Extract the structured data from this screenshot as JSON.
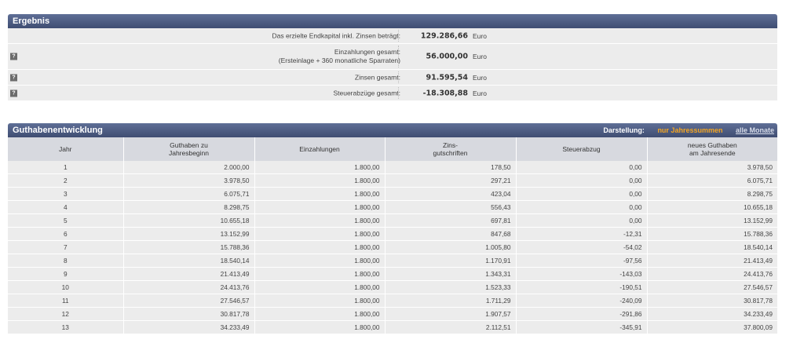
{
  "ergebnis": {
    "title": "Ergebnis",
    "rows": [
      {
        "label": "Das erzielte Endkapital inkl. Zinsen beträgt:",
        "label2": "",
        "value": "129.286,66",
        "unit": "Euro",
        "help": ""
      },
      {
        "label": "Einzahlungen gesamt:",
        "label2": "(Ersteinlage + 360 monatliche Sparraten)",
        "value": "56.000,00",
        "unit": "Euro",
        "help": "?"
      },
      {
        "label": "Zinsen gesamt:",
        "label2": "",
        "value": "91.595,54",
        "unit": "Euro",
        "help": "?"
      },
      {
        "label": "Steuerabzüge gesamt:",
        "label2": "",
        "value": "-18.308,88",
        "unit": "Euro",
        "help": "?"
      }
    ]
  },
  "guthaben": {
    "title": "Guthabenentwicklung",
    "darstellung_label": "Darstellung:",
    "active_option": "nur Jahressummen",
    "other_option": "alle Monate",
    "columns": [
      {
        "l1": "Jahr",
        "l2": ""
      },
      {
        "l1": "Guthaben zu",
        "l2": "Jahresbeginn"
      },
      {
        "l1": "Einzahlungen",
        "l2": ""
      },
      {
        "l1": "Zins-",
        "l2": "gutschriften"
      },
      {
        "l1": "Steuerabzug",
        "l2": ""
      },
      {
        "l1": "neues Guthaben",
        "l2": "am Jahresende"
      }
    ],
    "rows": [
      [
        "1",
        "2.000,00",
        "1.800,00",
        "178,50",
        "0,00",
        "3.978,50"
      ],
      [
        "2",
        "3.978,50",
        "1.800,00",
        "297,21",
        "0,00",
        "6.075,71"
      ],
      [
        "3",
        "6.075,71",
        "1.800,00",
        "423,04",
        "0,00",
        "8.298,75"
      ],
      [
        "4",
        "8.298,75",
        "1.800,00",
        "556,43",
        "0,00",
        "10.655,18"
      ],
      [
        "5",
        "10.655,18",
        "1.800,00",
        "697,81",
        "0,00",
        "13.152,99"
      ],
      [
        "6",
        "13.152,99",
        "1.800,00",
        "847,68",
        "-12,31",
        "15.788,36"
      ],
      [
        "7",
        "15.788,36",
        "1.800,00",
        "1.005,80",
        "-54,02",
        "18.540,14"
      ],
      [
        "8",
        "18.540,14",
        "1.800,00",
        "1.170,91",
        "-97,56",
        "21.413,49"
      ],
      [
        "9",
        "21.413,49",
        "1.800,00",
        "1.343,31",
        "-143,03",
        "24.413,76"
      ],
      [
        "10",
        "24.413,76",
        "1.800,00",
        "1.523,33",
        "-190,51",
        "27.546,57"
      ],
      [
        "11",
        "27.546,57",
        "1.800,00",
        "1.711,29",
        "-240,09",
        "30.817,78"
      ],
      [
        "12",
        "30.817,78",
        "1.800,00",
        "1.907,57",
        "-291,86",
        "34.233,49"
      ],
      [
        "13",
        "34.233,49",
        "1.800,00",
        "2.112,51",
        "-345,91",
        "37.800,09"
      ]
    ]
  }
}
